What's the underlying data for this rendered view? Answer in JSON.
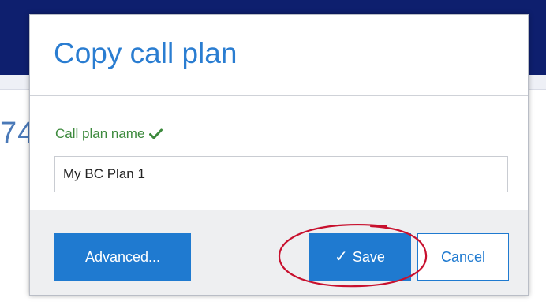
{
  "background": {
    "side_text": "74"
  },
  "dialog": {
    "title": "Copy call plan",
    "field": {
      "label": "Call plan name",
      "value": "My BC Plan 1",
      "placeholder": ""
    },
    "buttons": {
      "advanced": "Advanced...",
      "save_icon": "✓",
      "save": "Save",
      "cancel": "Cancel"
    }
  },
  "colors": {
    "header_bg": "#0e1f6e",
    "accent": "#1f7ad0",
    "valid_green": "#3d8a3d",
    "annotation_red": "#c8102e"
  },
  "icons": {
    "label_check": "checkmark-icon",
    "save_check": "checkmark-icon"
  }
}
